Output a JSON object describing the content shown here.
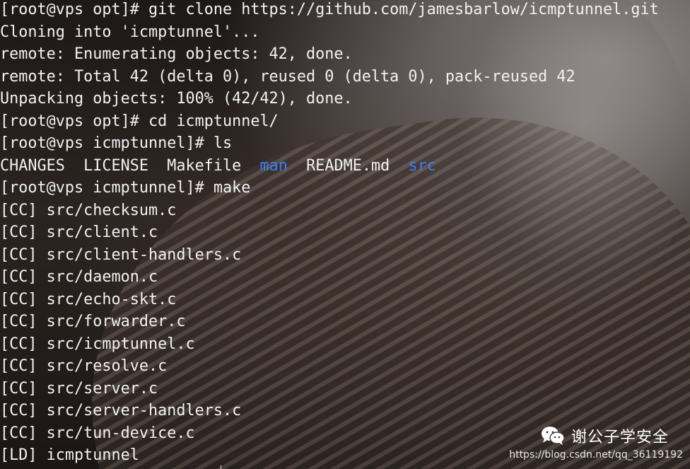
{
  "terminal": {
    "lines": [
      "[root@vps opt]# git clone https://github.com/jamesbarlow/icmptunnel.git",
      "Cloning into 'icmptunnel'...",
      "remote: Enumerating objects: 42, done.",
      "remote: Total 42 (delta 0), reused 0 (delta 0), pack-reused 42",
      "Unpacking objects: 100% (42/42), done.",
      "[root@vps opt]# cd icmptunnel/",
      "[root@vps icmptunnel]# ls"
    ],
    "ls_output": {
      "files": [
        "CHANGES",
        "LICENSE",
        "Makefile",
        "README.md"
      ],
      "dirs": [
        "man",
        "src"
      ]
    },
    "build_lines": [
      "[root@vps icmptunnel]# make",
      "[CC] src/checksum.c",
      "[CC] src/client.c",
      "[CC] src/client-handlers.c",
      "[CC] src/daemon.c",
      "[CC] src/echo-skt.c",
      "[CC] src/forwarder.c",
      "[CC] src/icmptunnel.c",
      "[CC] src/resolve.c",
      "[CC] src/server.c",
      "[CC] src/server-handlers.c",
      "[CC] src/tun-device.c",
      "[LD] icmptunnel"
    ]
  },
  "watermark": {
    "icon": "wechat-icon",
    "title": "谢公子学安全",
    "url": "https://blog.csdn.net/qq_36119192"
  },
  "colors": {
    "text": "#f2f2f2",
    "directory": "#3b7ff5"
  }
}
